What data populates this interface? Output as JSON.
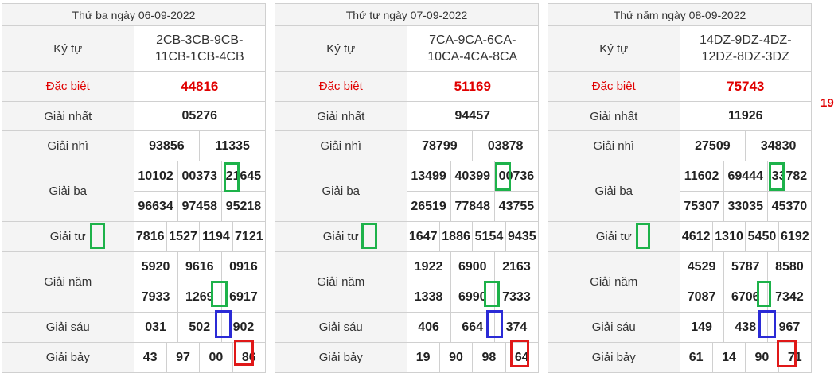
{
  "labels": {
    "kytu": "Ký tự",
    "db": "Đặc biệt",
    "g1": "Giải nhất",
    "g2": "Giải nhì",
    "g3": "Giải ba",
    "g4": "Giải tư",
    "g5": "Giải năm",
    "g6": "Giải sáu",
    "g7": "Giải bảy"
  },
  "side_note": "19",
  "colors": {
    "special": "#e00000",
    "green_mark": "#1db24a",
    "blue_mark": "#2b2bd6",
    "red_mark": "#e01818"
  },
  "panels": [
    {
      "date": "Thứ ba ngày 06-09-2022",
      "kytu": "2CB-3CB-9CB-11CB-1CB-4CB",
      "db": "44816",
      "g1": "05276",
      "g2": [
        "93856",
        "11335"
      ],
      "g3": [
        [
          "10102",
          "00373",
          "21645"
        ],
        [
          "96634",
          "97458",
          "95218"
        ]
      ],
      "g4": [
        "7816",
        "1527",
        "1194",
        "7121"
      ],
      "g5": [
        [
          "5920",
          "9616",
          "0916"
        ],
        [
          "7933",
          "1269",
          "6917"
        ]
      ],
      "g6": [
        "031",
        "502",
        "902"
      ],
      "g7": [
        "43",
        "97",
        "00",
        "86"
      ]
    },
    {
      "date": "Thứ tư ngày 07-09-2022",
      "kytu": "7CA-9CA-6CA-10CA-4CA-8CA",
      "db": "51169",
      "g1": "94457",
      "g2": [
        "78799",
        "03878"
      ],
      "g3": [
        [
          "13499",
          "40399",
          "00736"
        ],
        [
          "26519",
          "77848",
          "43755"
        ]
      ],
      "g4": [
        "1647",
        "1886",
        "5154",
        "9435"
      ],
      "g5": [
        [
          "1922",
          "6900",
          "2163"
        ],
        [
          "1338",
          "6990",
          "7333"
        ]
      ],
      "g6": [
        "406",
        "664",
        "374"
      ],
      "g7": [
        "19",
        "90",
        "98",
        "64"
      ]
    },
    {
      "date": "Thứ năm ngày 08-09-2022",
      "kytu": "14DZ-9DZ-4DZ-12DZ-8DZ-3DZ",
      "db": "75743",
      "g1": "11926",
      "g2": [
        "27509",
        "34830"
      ],
      "g3": [
        [
          "11602",
          "69444",
          "33782"
        ],
        [
          "75307",
          "33035",
          "45370"
        ]
      ],
      "g4": [
        "4612",
        "1310",
        "5450",
        "6192"
      ],
      "g5": [
        [
          "4529",
          "5787",
          "8580"
        ],
        [
          "7087",
          "6706",
          "7342"
        ]
      ],
      "g6": [
        "149",
        "438",
        "967"
      ],
      "g7": [
        "61",
        "14",
        "90",
        "71"
      ]
    }
  ]
}
